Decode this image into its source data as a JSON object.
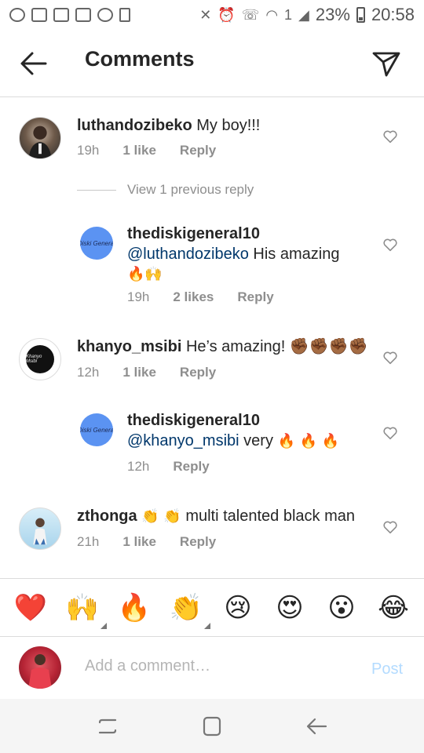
{
  "status_bar": {
    "battery": "23%",
    "time": "20:58",
    "sim_badge": "1"
  },
  "header": {
    "title": "Comments"
  },
  "comments": [
    {
      "user": "luthandozibeko",
      "text": "My boy!!!",
      "time": "19h",
      "likes": "1 like",
      "reply": "Reply"
    },
    {
      "user": "khanyo_msibi",
      "text": "He’s amazing! ✊🏾✊🏾✊🏾✊🏾",
      "time": "12h",
      "likes": "1 like",
      "reply": "Reply"
    },
    {
      "user": "zthonga",
      "text_pre": "👏 👏",
      "text": "multi talented black man",
      "time": "21h",
      "likes": "1 like",
      "reply": "Reply"
    }
  ],
  "view_previous": "View 1 previous reply",
  "replies": [
    {
      "user": "thediskigeneral10",
      "mention": "@luthandozibeko",
      "text": "His amazing",
      "emoji": "🔥🙌",
      "time": "19h",
      "likes": "2 likes",
      "reply": "Reply",
      "avatar_text": "Diski General"
    },
    {
      "user": "thediskigeneral10",
      "mention": "@khanyo_msibi",
      "text": "very",
      "emoji": "🔥 🔥 🔥",
      "time": "12h",
      "reply": "Reply",
      "avatar_text": "Diski General"
    }
  ],
  "khanyo_avatar_text": "Khanyo Msibi",
  "reactions": [
    "❤️",
    "🙌",
    "🔥",
    "👏",
    "😢",
    "😍",
    "😮",
    "😂"
  ],
  "composer": {
    "placeholder": "Add a comment…",
    "post_label": "Post"
  },
  "colors": {
    "primary_text": "#262626",
    "secondary_text": "#8e8e8e",
    "mention": "#00376b",
    "post_disabled": "#b3dbff",
    "divider": "#dbdbdb"
  }
}
